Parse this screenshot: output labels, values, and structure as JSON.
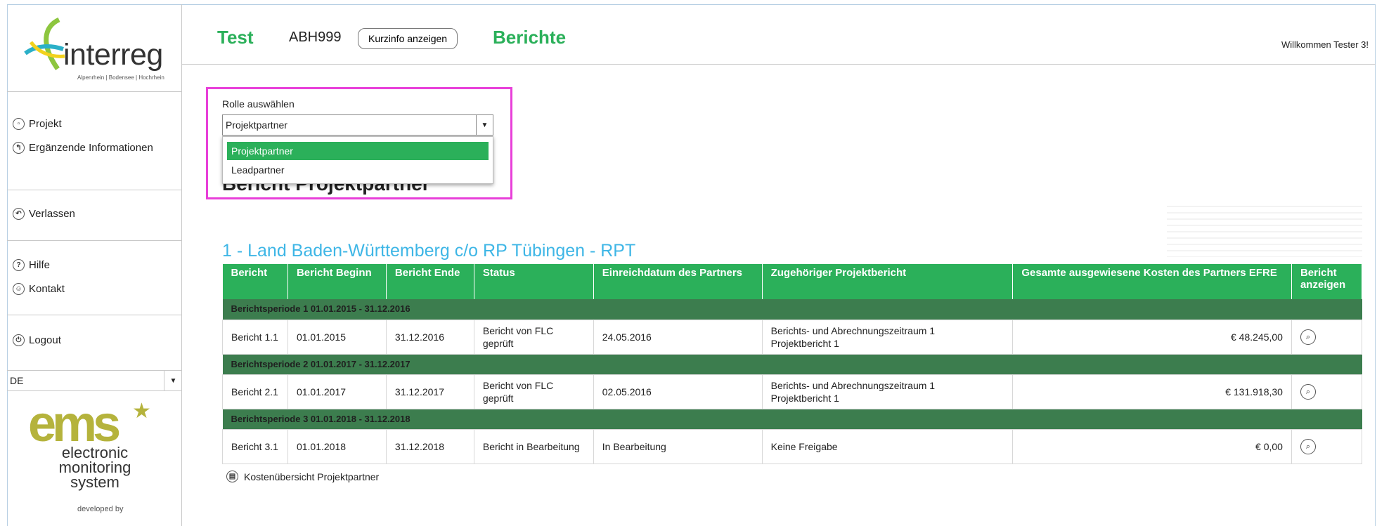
{
  "brand": {
    "logo_text": "interreg",
    "logo_tagline": "Alpenrhein | Bodensee | Hochrhein",
    "ems_logo": "ems",
    "ems_text": [
      "electronic",
      "monitoring",
      "system"
    ],
    "developed_by": "developed by"
  },
  "sidebar": {
    "items": [
      {
        "label": "Projekt",
        "icon": "document-icon"
      },
      {
        "label": "Ergänzende Informationen",
        "icon": "arrow-icon"
      },
      {
        "label": "Verlassen",
        "icon": "undo-icon"
      },
      {
        "label": "Hilfe",
        "icon": "help-icon"
      },
      {
        "label": "Kontakt",
        "icon": "person-icon"
      },
      {
        "label": "Logout",
        "icon": "power-icon"
      }
    ],
    "language": "DE"
  },
  "header": {
    "project": "Test",
    "code": "ABH999",
    "info_button": "Kurzinfo anzeigen",
    "section": "Berichte",
    "welcome": "Willkommen Tester 3!"
  },
  "role": {
    "label": "Rolle auswählen",
    "selected": "Projektpartner",
    "options": [
      "Projektpartner",
      "Leadpartner"
    ]
  },
  "page_title": "Bericht Projektpartner",
  "partner_title": "1 - Land Baden-Württemberg c/o RP Tübingen - RPT",
  "table": {
    "headers": [
      "Bericht",
      "Bericht Beginn",
      "Bericht Ende",
      "Status",
      "Einreichdatum des Partners",
      "Zugehöriger Projektbericht",
      "Gesamte ausgewiesene Kosten des Partners EFRE",
      "Bericht anzeigen"
    ],
    "periods": [
      {
        "label": "Berichtsperiode 1 01.01.2015 - 31.12.2016",
        "row": {
          "bericht": "Bericht 1.1",
          "beginn": "01.01.2015",
          "ende": "31.12.2016",
          "status": "Bericht von FLC geprüft",
          "einreichdatum": "24.05.2016",
          "projektbericht_1": "Berichts- und Abrechnungszeitraum 1",
          "projektbericht_2": "Projektbericht 1",
          "kosten": "€ 48.245,00"
        }
      },
      {
        "label": "Berichtsperiode 2 01.01.2017 - 31.12.2017",
        "row": {
          "bericht": "Bericht 2.1",
          "beginn": "01.01.2017",
          "ende": "31.12.2017",
          "status": "Bericht von FLC geprüft",
          "einreichdatum": "02.05.2016",
          "projektbericht_1": "Berichts- und Abrechnungszeitraum 1",
          "projektbericht_2": "Projektbericht 1",
          "kosten": "€ 131.918,30"
        }
      },
      {
        "label": "Berichtsperiode 3 01.01.2018 - 31.12.2018",
        "row": {
          "bericht": "Bericht 3.1",
          "beginn": "01.01.2018",
          "ende": "31.12.2018",
          "status": "Bericht in Bearbeitung",
          "einreichdatum": "In Bearbeitung",
          "projektbericht_1": "Keine Freigabe",
          "projektbericht_2": "",
          "kosten": "€ 0,00"
        }
      }
    ]
  },
  "cost_overview_link": "Kostenübersicht Projektpartner",
  "colors": {
    "green": "#2bb05a",
    "period_green": "#3c7d4e",
    "highlight_magenta": "#e83fd9",
    "partner_blue": "#3eb6e6",
    "ems_olive": "#b5b33c"
  }
}
